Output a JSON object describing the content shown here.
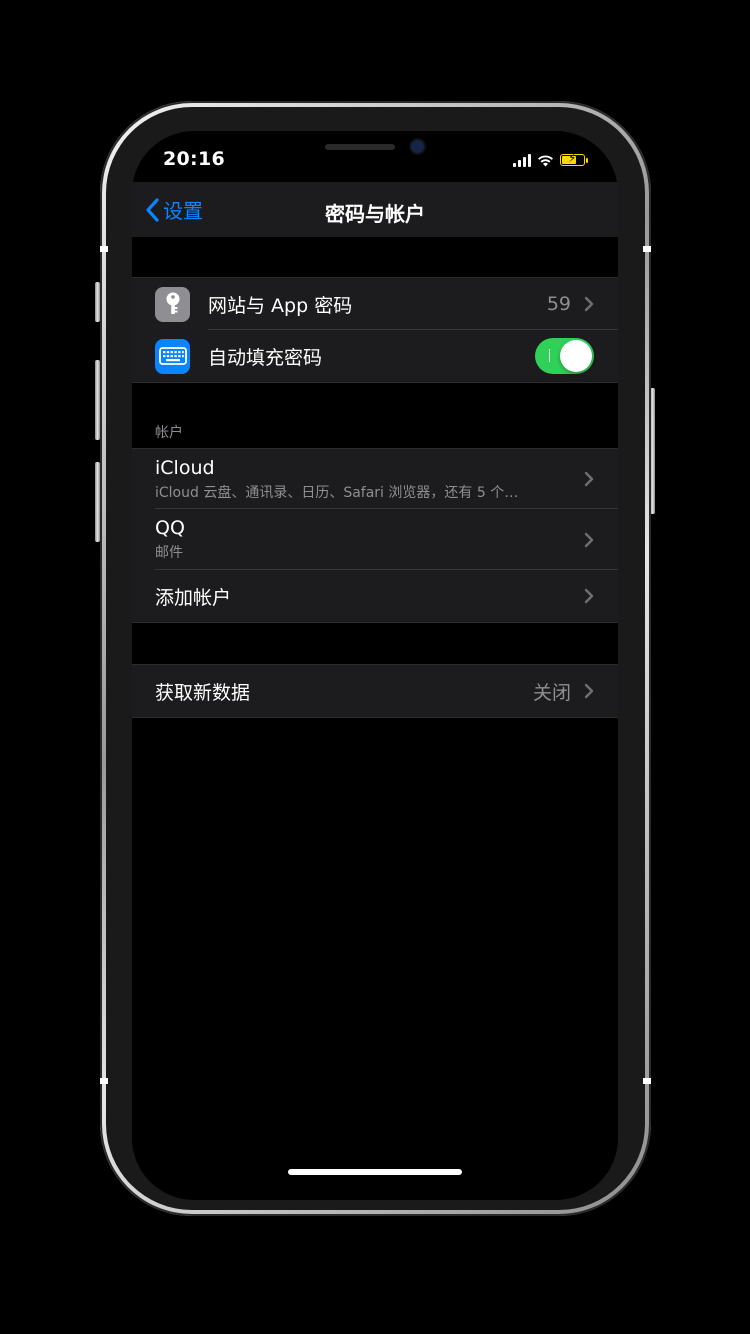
{
  "status_bar": {
    "time": "20:16"
  },
  "nav": {
    "back_label": "设置",
    "title": "密码与帐户"
  },
  "passwords_group": {
    "website_passwords": {
      "label": "网站与 App 密码",
      "value": "59"
    },
    "autofill": {
      "label": "自动填充密码",
      "enabled": true
    }
  },
  "accounts_section": {
    "header": "帐户",
    "accounts": [
      {
        "name": "iCloud",
        "detail": "iCloud 云盘、通讯录、日历、Safari 浏览器，还有 5 个…"
      },
      {
        "name": "QQ",
        "detail": "邮件"
      }
    ],
    "add_account_label": "添加帐户"
  },
  "fetch_group": {
    "label": "获取新数据",
    "value": "关闭"
  },
  "colors": {
    "accent": "#0a84ff",
    "toggle_on": "#30d158",
    "battery": "#ffd60a",
    "key_icon_bg": "#8e8e93",
    "keyboard_icon_bg": "#0a84ff"
  }
}
